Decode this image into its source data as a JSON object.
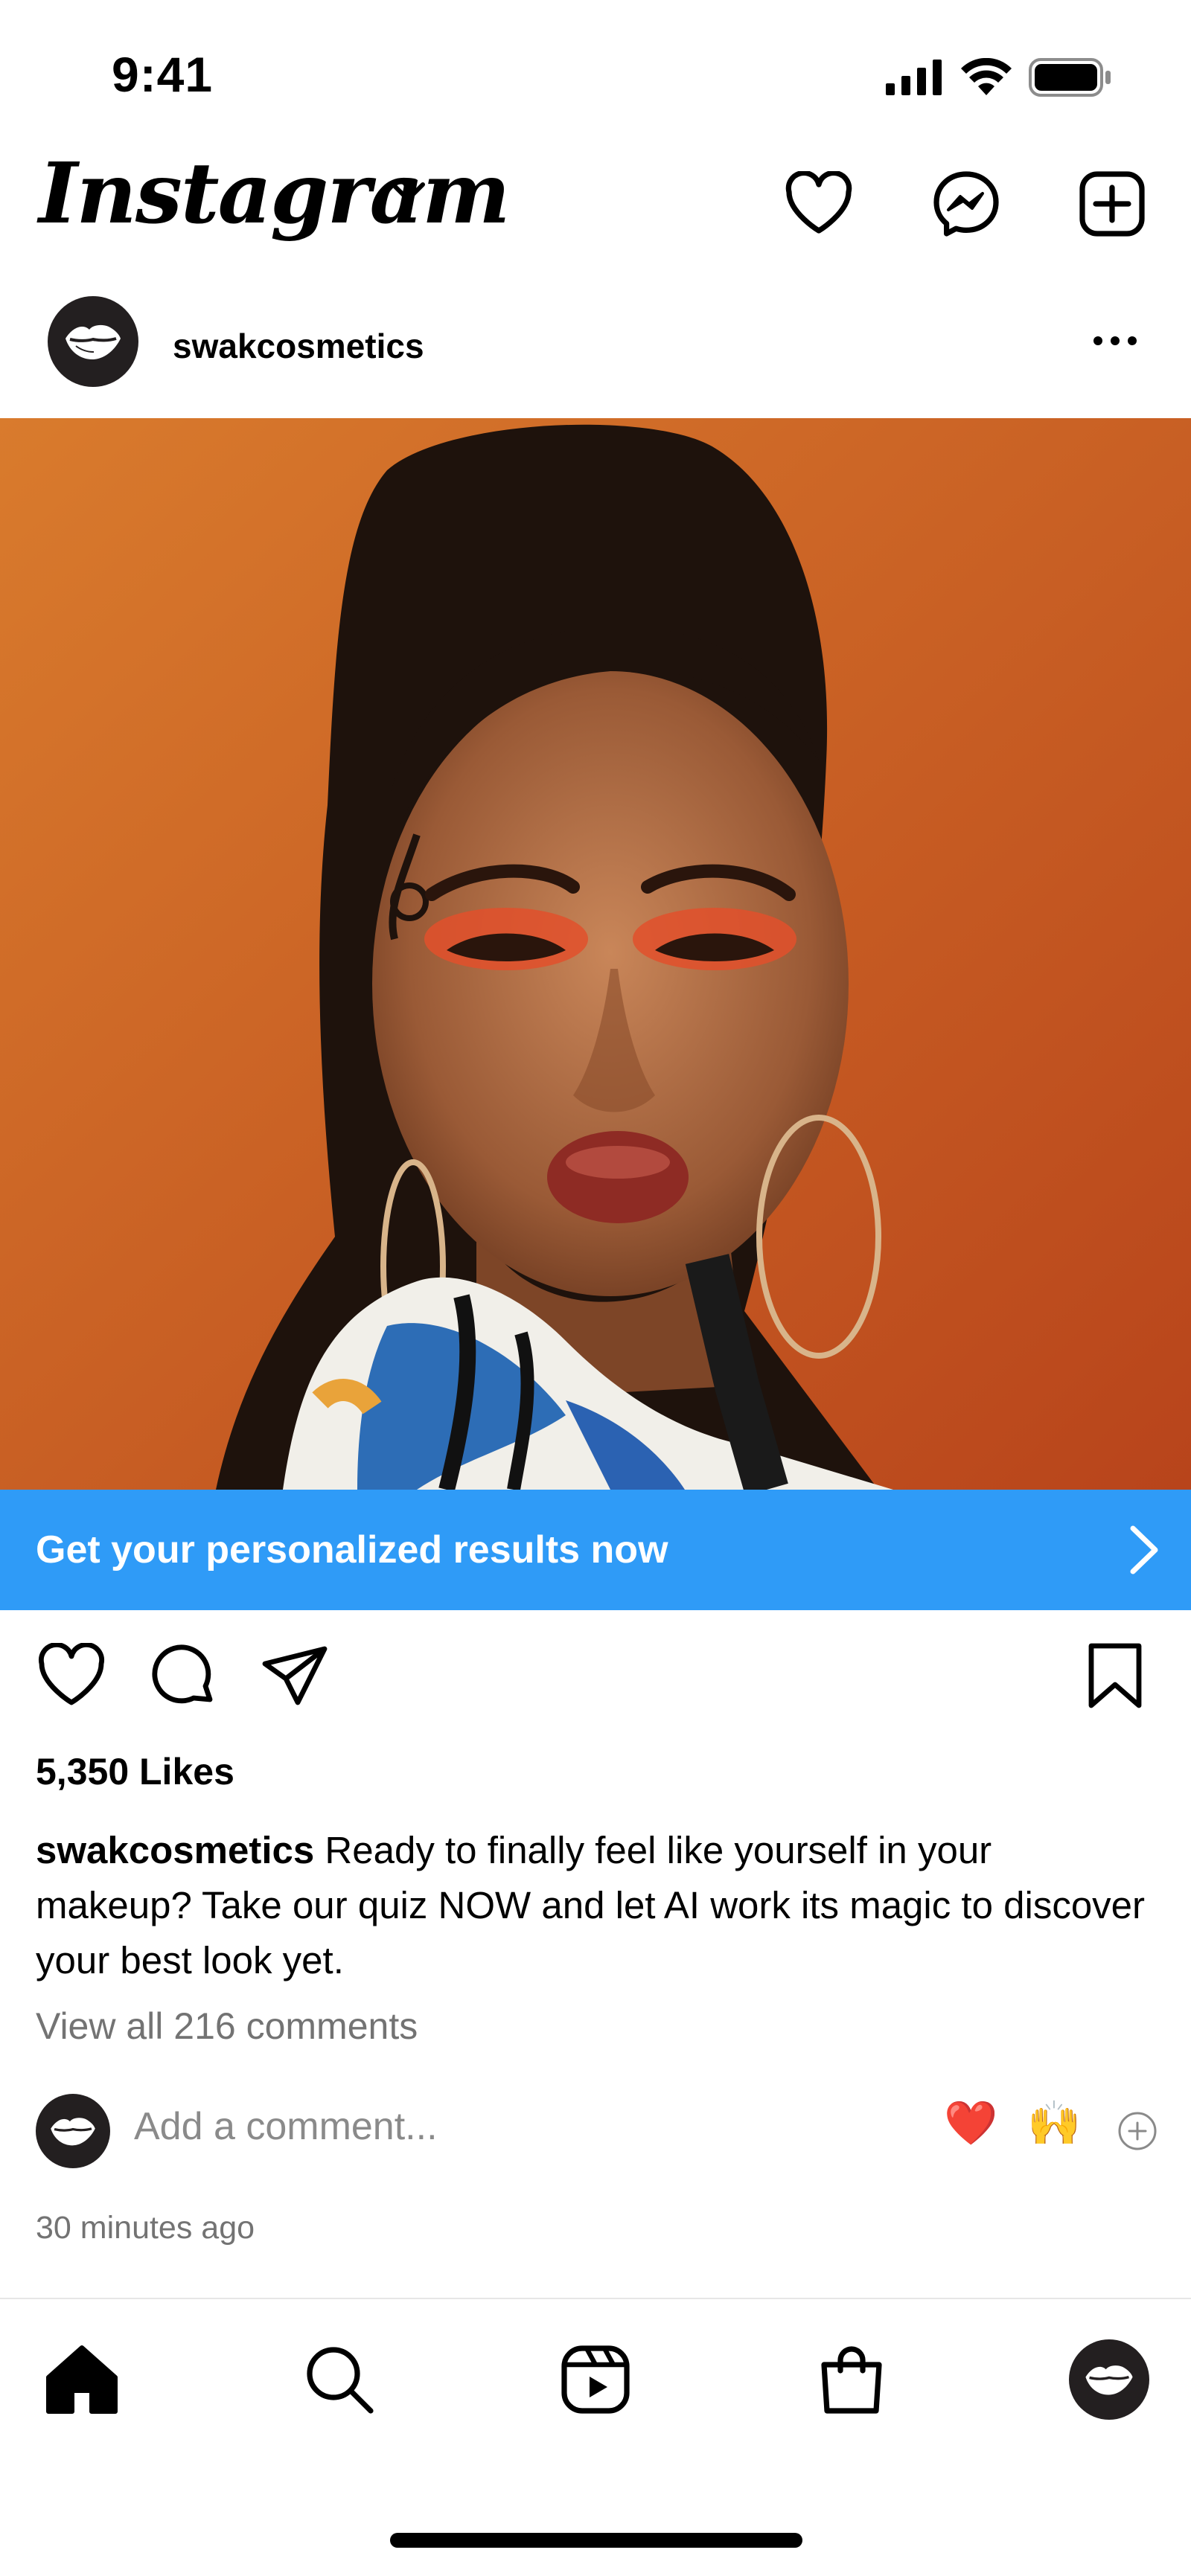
{
  "status_bar": {
    "time": "9:41"
  },
  "header": {
    "app_title": "Instagram"
  },
  "post": {
    "username": "swakcosmetics",
    "cta_label": "Get your personalized results now",
    "likes": "5,350 Likes",
    "caption_user": "swakcosmetics",
    "caption_text": " Ready to finally feel like yourself in your makeup? Take our quiz NOW and let AI work its magic to discover your best look yet.",
    "view_comments": "View all 216 comments",
    "comment_placeholder": "Add a comment...",
    "quick_reactions": [
      "❤️",
      "🙌"
    ],
    "timestamp": "30 minutes ago"
  },
  "colors": {
    "cta": "#2f9bf7",
    "avatar_bg": "#231f20",
    "muted_text": "#737373"
  },
  "icons": {
    "header": [
      "heart-icon",
      "messenger-icon",
      "new-post-icon"
    ],
    "post_actions": [
      "like-icon",
      "comment-icon",
      "share-icon",
      "bookmark-icon"
    ],
    "bottom_nav": [
      "home-icon",
      "search-icon",
      "reels-icon",
      "shop-icon",
      "profile-avatar"
    ]
  }
}
